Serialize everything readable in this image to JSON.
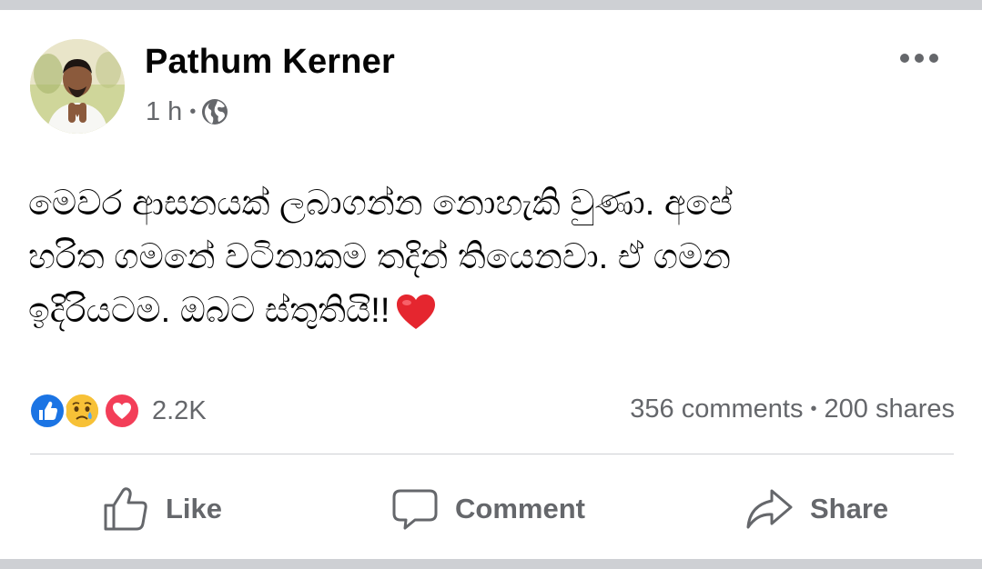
{
  "post": {
    "author": "Pathum Kerner",
    "time": "1 h",
    "separator": "•",
    "audience_icon": "globe-icon",
    "text": "මෙවර ආසනයක් ලබාගන්න නොහැකි වුණා. අපේ\nහරිත ගමනේ වටිනාකම තදින් තියෙනවා. ඒ ගමන\nඉදිරියටම. ඔබට ස්තුතියි!!",
    "emoji": "heart-emoji"
  },
  "reactions": {
    "icons": [
      "like-icon",
      "sad-icon",
      "love-icon"
    ],
    "count": "2.2K",
    "comments": "356 comments",
    "dot": "•",
    "shares": "200 shares"
  },
  "actions": {
    "like": "Like",
    "comment": "Comment",
    "share": "Share"
  },
  "colors": {
    "like_blue": "#1b74e4",
    "love_red": "#f33e58",
    "sad_yellow": "#f7c137",
    "secondary_text": "#65676b",
    "primary_text": "#050505",
    "page_background": "#ced0d4"
  }
}
